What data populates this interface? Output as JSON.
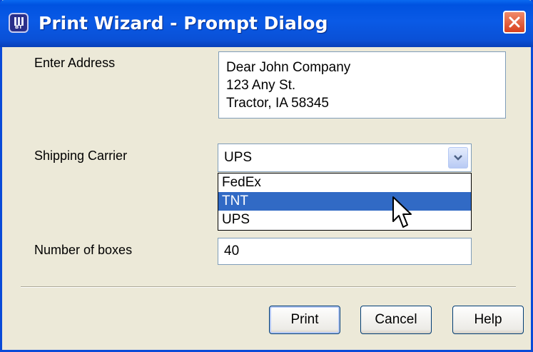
{
  "window": {
    "title": "Print Wizard - Prompt Dialog",
    "icon": "app-icon",
    "close_icon": "close-icon"
  },
  "form": {
    "address": {
      "label": "Enter Address",
      "lines": [
        "Dear John Company",
        "123 Any St.",
        "Tractor, IA 58345"
      ]
    },
    "carrier": {
      "label": "Shipping Carrier",
      "value": "UPS",
      "options": [
        "FedEx",
        "TNT",
        "UPS"
      ],
      "highlighted": "TNT"
    },
    "boxes": {
      "label": "Number of boxes",
      "value": "40"
    }
  },
  "buttons": {
    "print": "Print",
    "cancel": "Cancel",
    "help": "Help"
  },
  "colors": {
    "title_bar": "#0a5ae6",
    "highlight": "#316ac5",
    "dialog_bg": "#ece9d8",
    "close_button": "#d8401e"
  }
}
